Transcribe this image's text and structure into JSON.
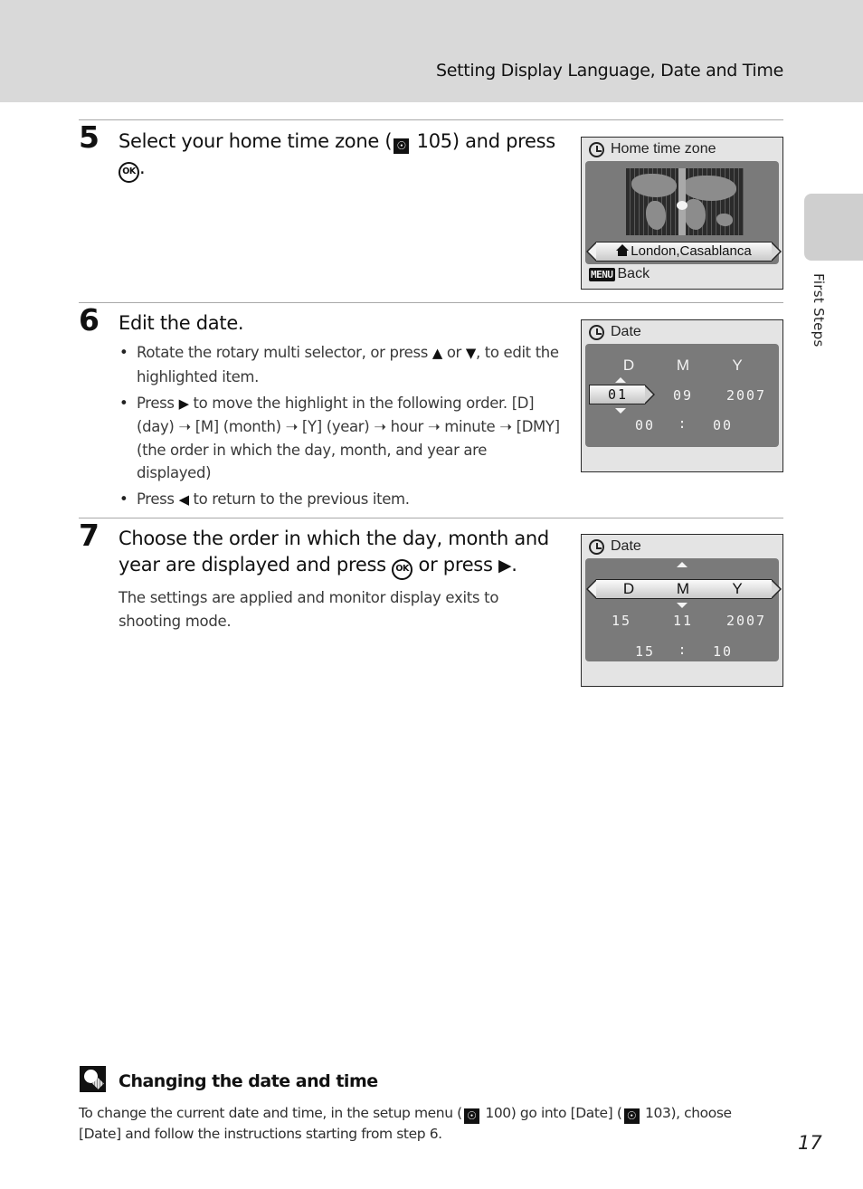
{
  "header": {
    "title": "Setting Display Language, Date and Time"
  },
  "side_tab": {
    "label": "First Steps"
  },
  "steps": [
    {
      "number": "5",
      "title_pre": "Select your home time zone (",
      "title_ref": "105",
      "title_post": ") and press",
      "title_end": ".",
      "screen": {
        "title": "Home time zone",
        "selected_zone": "London,Casablanca",
        "footer_key": "MENU",
        "footer_label": "Back"
      }
    },
    {
      "number": "6",
      "title": "Edit the date.",
      "bullets": [
        {
          "pre": "Rotate the rotary multi selector, or press ",
          "mid1": "▲",
          "mid": " or ",
          "mid2": "▼",
          "post": ", to edit the highlighted item."
        },
        {
          "pre": "Press ",
          "mid1": "▶",
          "post": " to move the highlight in the following order. [D] (day) ➝ [M] (month) ➝ [Y] (year) ➝ hour ➝ minute ➝ [DMY] (the order in which the day, month, and year are displayed)"
        },
        {
          "pre": "Press ",
          "mid1": "◀",
          "post": " to return to the previous item."
        }
      ],
      "screen": {
        "title": "Date",
        "headers": [
          "D",
          "M",
          "Y"
        ],
        "day": "01",
        "month": "09",
        "year": "2007",
        "hour": "00",
        "separator": ":",
        "minute": "00",
        "highlighted": "D"
      }
    },
    {
      "number": "7",
      "title_line1": "Choose the order in which the day, month and",
      "title_line2_pre": "year are displayed and press",
      "title_line2_mid": "or press",
      "title_line2_arrow": "▶",
      "title_line2_end": ".",
      "body": "The settings are applied and monitor display exits to shooting mode.",
      "screen": {
        "title": "Date",
        "headers": [
          "D",
          "M",
          "Y"
        ],
        "day": "15",
        "month": "11",
        "year": "2007",
        "hour": "15",
        "separator": ":",
        "minute": "10",
        "highlighted": "DMY"
      }
    }
  ],
  "ok_label": "OK",
  "ref_glyph": "☉",
  "tip": {
    "title": "Changing the date and time",
    "text_1": "To change the current date and time, in the setup menu (",
    "ref_1": "100",
    "text_2": ") go into [Date] (",
    "ref_2": "103",
    "text_3": "), choose [Date] and follow the instructions starting from step 6."
  },
  "page_number": "17"
}
